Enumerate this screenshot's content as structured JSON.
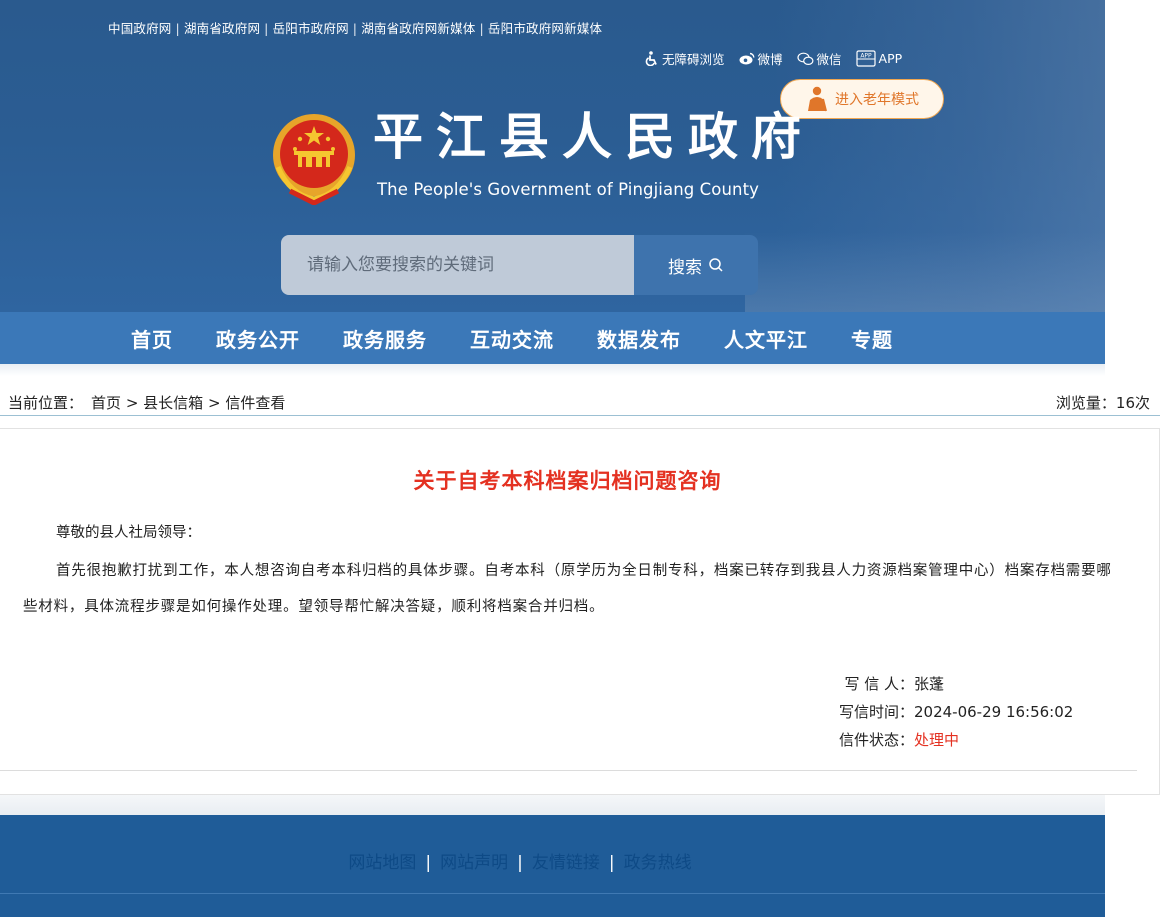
{
  "header": {
    "top_links": [
      "中国政府网",
      "湖南省政府网",
      "岳阳市政府网",
      "湖南省政府网新媒体",
      "岳阳市政府网新媒体"
    ],
    "separator": "|",
    "tools": {
      "accessibility": "无障碍浏览",
      "weibo": "微博",
      "wechat": "微信",
      "app": "APP",
      "app_icon_text": "APP"
    },
    "elder_mode": "进入老年模式",
    "site_title": "平江县人民政府",
    "site_subtitle": "The People's Government of Pingjiang County",
    "search": {
      "placeholder": "请输入您要搜索的关键词",
      "button": "搜索"
    }
  },
  "nav": {
    "items": [
      "首页",
      "政务公开",
      "政务服务",
      "互动交流",
      "数据发布",
      "人文平江",
      "专题"
    ]
  },
  "breadcrumb": {
    "label": "当前位置：",
    "items": [
      "首页",
      "县长信箱",
      "信件查看"
    ],
    "separator": ">",
    "views_label": "浏览量：",
    "views_value": "16次"
  },
  "letter": {
    "title": "关于自考本科档案归档问题咨询",
    "greeting": "尊敬的县人社局领导：",
    "body": "首先很抱歉打扰到工作，本人想咨询自考本科归档的具体步骤。自考本科（原学历为全日制专科，档案已转存到我县人力资源档案管理中心）档案存档需要哪些材料，具体流程步骤是如何操作处理。望领导帮忙解决答疑，顺利将档案合并归档。",
    "writer_label": "写 信 人：",
    "writer": "张蓬",
    "time_label": "写信时间：",
    "time": "2024-06-29 16:56:02",
    "status_label": "信件状态：",
    "status": "处理中",
    "status_color": "#e43121"
  },
  "footer": {
    "links": [
      "网站地图",
      "网站声明",
      "友情链接",
      "政务热线"
    ],
    "separator": "|"
  },
  "colors": {
    "header_blue": "#2b5d93",
    "nav_blue": "#3b78b8",
    "title_red": "#e43121",
    "elder_orange": "#e0762a",
    "footer_blue": "#1f5c98"
  }
}
